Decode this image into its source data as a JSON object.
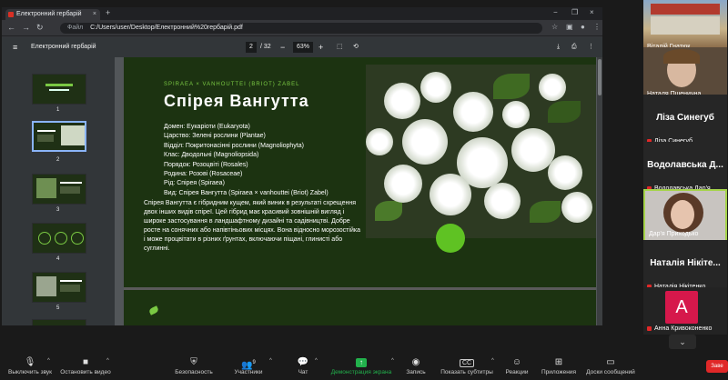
{
  "browser": {
    "tab_title": "Електронний гербарій",
    "tab_close": "×",
    "new_tab": "+",
    "win_min": "−",
    "win_max": "❐",
    "win_close": "×",
    "file_label": "Файл",
    "url": "C:/Users/user/Desktop/Електронний%20гербарій.pdf"
  },
  "pdf_toolbar": {
    "title": "Електронний гербарій",
    "current_page": "2",
    "total_pages": "/ 32",
    "zoom": "63%",
    "zoom_out": "−",
    "zoom_in": "+"
  },
  "thumbnails": [
    {
      "number": "1"
    },
    {
      "number": "2",
      "selected": true
    },
    {
      "number": "3"
    },
    {
      "number": "4"
    },
    {
      "number": "5"
    }
  ],
  "slide": {
    "latin_name": "SPIRAEA × VANHOUTTEI (BRIOT) ZABEL",
    "title": "Спірея Вангутта",
    "taxonomy": [
      "Домен: Еукаріоти (Eukaryota)",
      "Царство: Зелені рослини (Plantae)",
      "Відділ: Покритонасінні рослини (Magnoliophyta)",
      "Клас: Дводольні (Magnoliopsida)",
      "Порядок: Розоцвіті (Rosales)",
      "Родина: Розові (Rosaceae)",
      "Рід: Спірея (Spiraea)",
      "Вид: Спірея Вангутта (Spiraea × vanhouttei (Briot) Zabel)"
    ],
    "description": "Спірея Вангутта є гібридним кущем, який виник в результаті схрещення двох інших видів спіреї. Цей гібрид має красивий зовнішній вигляд і широке застосування в ландшафтному дизайні та садівництві. Добре росте на сонячних або напівтіньових місцях. Вона відносно морозостійка і може процвітати в різних ґрунтах, включаючи піщані, глинисті або суглинні."
  },
  "participants": [
    {
      "name": "Віталій Гнатюк",
      "type": "video"
    },
    {
      "name": "Наталя Пшенична",
      "type": "video"
    },
    {
      "name": "Ліза Синегуб",
      "display": "Ліза Синегуб",
      "type": "name"
    },
    {
      "name": "Водолавська Дар'я",
      "display": "Водолавська Д...",
      "type": "name"
    },
    {
      "name": "Дар'я Приходько",
      "type": "video",
      "active": true
    },
    {
      "name": "Наталія Нікітенко",
      "display": "Наталія Нікіте...",
      "type": "name"
    },
    {
      "name": "Анна Кривоконенко",
      "avatar_letter": "A",
      "type": "avatar"
    }
  ],
  "scroll_down": "⌄",
  "toolbar": {
    "mute": "Выключить звук",
    "video": "Остановить видео",
    "security": "Безопасность",
    "participants": "Участники",
    "participants_count": "9",
    "chat": "Чат",
    "share": "Демонстрация экрана",
    "record": "Запись",
    "captions": "Показать субтитры",
    "cc": "CC",
    "reactions": "Реакции",
    "apps": "Приложения",
    "whiteboard": "Доски сообщений",
    "leave": "Заве"
  },
  "colors": {
    "slide_bg": "#1c3311",
    "accent_green": "#7ac943",
    "share_green": "#22b24c",
    "leave_red": "#e02828",
    "active_border": "#a5d34a"
  }
}
